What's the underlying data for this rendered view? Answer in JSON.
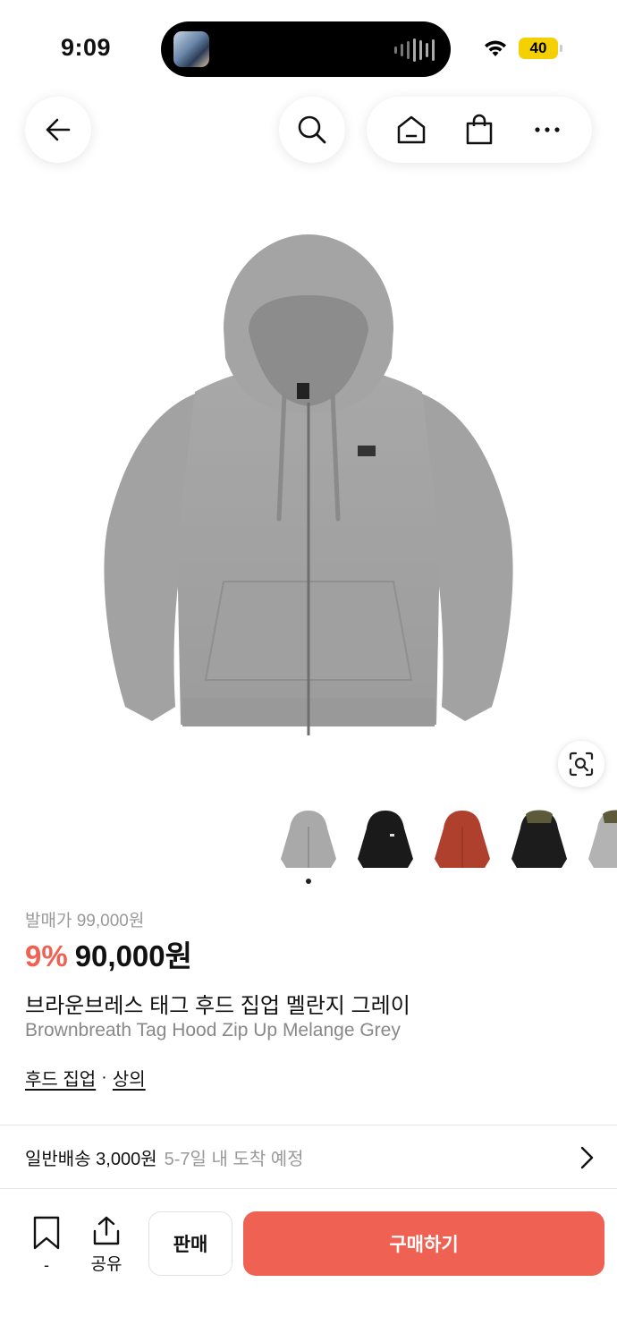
{
  "status_bar": {
    "time": "9:09",
    "battery": "40"
  },
  "nav": {
    "icons": [
      "back-arrow-icon",
      "search-icon",
      "home-icon",
      "shopping-bag-icon",
      "more-icon"
    ]
  },
  "product": {
    "image": "grey-zip-hoodie",
    "thumbnails": [
      "grey-hoodie",
      "black-hoodie",
      "red-hoodie",
      "camo-black-hoodie",
      "grey-hoodie"
    ],
    "retail_price": "발매가 99,000원",
    "discount": "9%",
    "price": "90,000원",
    "title_ko": "브라운브레스 태그 후드 집업 멜란지 그레이",
    "title_en": "Brownbreath Tag Hood Zip Up Melange Grey",
    "categories": [
      "후드 집업",
      "상의"
    ],
    "category_separator": "·"
  },
  "shipping": {
    "main": "일반배송 3,000원",
    "sub": "5-7일 내 도착 예정"
  },
  "bottom_bar": {
    "bookmark_count": "-",
    "share_label": "공유",
    "sell_label": "판매",
    "buy_label": "구매하기"
  },
  "colors": {
    "accent": "#ef6253",
    "battery": "#f5d000"
  }
}
